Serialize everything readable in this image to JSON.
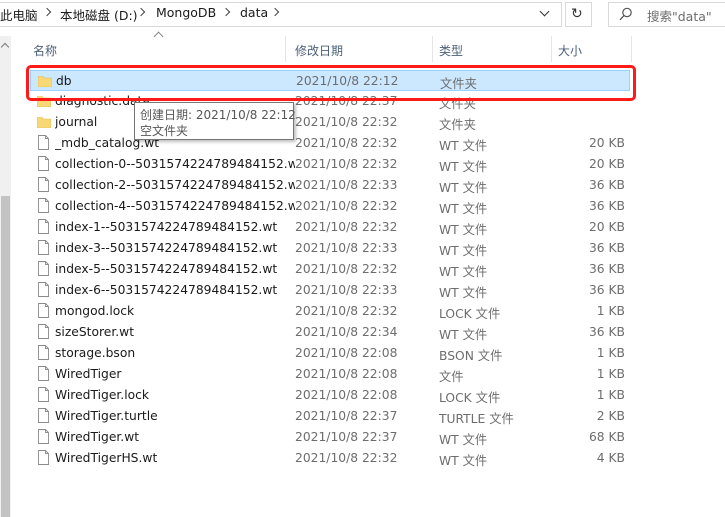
{
  "address": {
    "crumbs": [
      "此电脑",
      "本地磁盘 (D:)",
      "MongoDB",
      "data"
    ],
    "search_placeholder": "搜索\"data\""
  },
  "columns": {
    "name": "名称",
    "date": "修改日期",
    "type": "类型",
    "size": "大小"
  },
  "files": [
    {
      "name": "db",
      "date": "2021/10/8 22:12",
      "type": "文件夹",
      "size": "",
      "kind": "folder",
      "selected": true
    },
    {
      "name": "diagnostic.data",
      "date": "2021/10/8 22:37",
      "type": "文件夹",
      "size": "",
      "kind": "folder"
    },
    {
      "name": "journal",
      "date": "2021/10/8 22:32",
      "type": "文件夹",
      "size": "",
      "kind": "folder"
    },
    {
      "name": "_mdb_catalog.wt",
      "date": "2021/10/8 22:32",
      "type": "WT 文件",
      "size": "20 KB",
      "kind": "file"
    },
    {
      "name": "collection-0--5031574224789484152.wt",
      "date": "2021/10/8 22:32",
      "type": "WT 文件",
      "size": "20 KB",
      "kind": "file"
    },
    {
      "name": "collection-2--5031574224789484152.wt",
      "date": "2021/10/8 22:33",
      "type": "WT 文件",
      "size": "36 KB",
      "kind": "file"
    },
    {
      "name": "collection-4--5031574224789484152.wt",
      "date": "2021/10/8 22:32",
      "type": "WT 文件",
      "size": "36 KB",
      "kind": "file"
    },
    {
      "name": "index-1--5031574224789484152.wt",
      "date": "2021/10/8 22:32",
      "type": "WT 文件",
      "size": "20 KB",
      "kind": "file"
    },
    {
      "name": "index-3--5031574224789484152.wt",
      "date": "2021/10/8 22:33",
      "type": "WT 文件",
      "size": "36 KB",
      "kind": "file"
    },
    {
      "name": "index-5--5031574224789484152.wt",
      "date": "2021/10/8 22:32",
      "type": "WT 文件",
      "size": "36 KB",
      "kind": "file"
    },
    {
      "name": "index-6--5031574224789484152.wt",
      "date": "2021/10/8 22:33",
      "type": "WT 文件",
      "size": "36 KB",
      "kind": "file"
    },
    {
      "name": "mongod.lock",
      "date": "2021/10/8 22:32",
      "type": "LOCK 文件",
      "size": "1 KB",
      "kind": "file"
    },
    {
      "name": "sizeStorer.wt",
      "date": "2021/10/8 22:34",
      "type": "WT 文件",
      "size": "36 KB",
      "kind": "file"
    },
    {
      "name": "storage.bson",
      "date": "2021/10/8 22:08",
      "type": "BSON 文件",
      "size": "1 KB",
      "kind": "file"
    },
    {
      "name": "WiredTiger",
      "date": "2021/10/8 22:08",
      "type": "文件",
      "size": "1 KB",
      "kind": "file"
    },
    {
      "name": "WiredTiger.lock",
      "date": "2021/10/8 22:08",
      "type": "LOCK 文件",
      "size": "1 KB",
      "kind": "file"
    },
    {
      "name": "WiredTiger.turtle",
      "date": "2021/10/8 22:37",
      "type": "TURTLE 文件",
      "size": "2 KB",
      "kind": "file"
    },
    {
      "name": "WiredTiger.wt",
      "date": "2021/10/8 22:37",
      "type": "WT 文件",
      "size": "68 KB",
      "kind": "file"
    },
    {
      "name": "WiredTigerHS.wt",
      "date": "2021/10/8 22:32",
      "type": "WT 文件",
      "size": "4 KB",
      "kind": "file"
    }
  ],
  "tooltip": {
    "line1": "创建日期: 2021/10/8 22:12",
    "line2": "空文件夹"
  },
  "colors": {
    "selection_bg": "#cce8ff",
    "selection_border": "#99d1ff",
    "highlight": "#ff1a1a",
    "folder": "#f8d775"
  }
}
